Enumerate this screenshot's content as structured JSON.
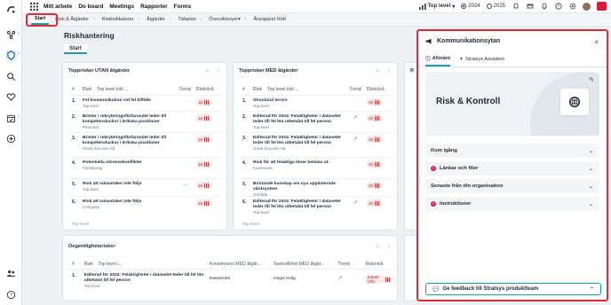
{
  "nav": {
    "items": [
      "Mitt arbete",
      "Do board",
      "Meetings",
      "Rapporter",
      "Forms"
    ]
  },
  "topbar": {
    "level_label": "Top level",
    "years": [
      "2024",
      "2025"
    ]
  },
  "breadcrumb": {
    "items": [
      "Start",
      "Risk & Åtgärder",
      "Riskindikatorer",
      "Åtgärder",
      "Tidsplan",
      "Översiktsvyer",
      "Årsrapport RoK"
    ]
  },
  "page": {
    "title": "Riskhantering",
    "tab": "Start"
  },
  "card1": {
    "title": "Topprisker UTAN åtgärder",
    "headers": [
      "#",
      "Risk",
      "Top level inkl ...",
      "Trend",
      "Risknivå"
    ],
    "rows": [
      {
        "num": "1.",
        "title": "Fel kommunikation vid fel tillfälle",
        "sub": "Top level",
        "trend": "",
        "level": "16"
      },
      {
        "num": "2.",
        "title": "Brister i rekryteringsförfarandet leder till kompetensluckor i kritiska positioner",
        "sub": "Personal",
        "trend": "",
        "level": "16"
      },
      {
        "num": "3.",
        "title": "Brister i rekryteringsförfarandet leder till kompetensluckor i kritiska positioner",
        "sub": "Great Success AB",
        "trend": "",
        "level": "16"
      },
      {
        "num": "4.",
        "title": "Potentiella intressekonflikter",
        "sub": "Försäljning",
        "trend": "",
        "level": "16"
      },
      {
        "num": "5.",
        "title": "Risk att ramavtalen inte följs",
        "sub": "Top level",
        "trend": "→",
        "level": "16"
      },
      {
        "num": "6.",
        "title": "Risk att ramavtalen inte följs",
        "sub": "Company",
        "trend": "",
        "level": "16"
      }
    ],
    "footer": "Top level"
  },
  "card2": {
    "title": "Topprisker MED åtgärder",
    "headers": [
      "#",
      "Risk",
      "Top level inkl ...",
      "Trend",
      "Risknivå"
    ],
    "rows": [
      {
        "num": "1.",
        "title": "Structural errors",
        "sub": "Top level",
        "trend": "",
        "level": "25"
      },
      {
        "num": "2.",
        "title": "Editerad för 2024: Felaktigheter i datasetet leder till fel lön utbetalat till fel person",
        "sub": "Top level",
        "trend": "↗",
        "level": "20"
      },
      {
        "num": "3.",
        "title": "Editerad för 2024: Felaktigheter i datasetet leder till fel lön utbetalat till fel person",
        "sub": "Great Success AB",
        "trend": "↗",
        "level": "20"
      },
      {
        "num": "4.",
        "title": "Risk för att felaktiga löner betalas ut.",
        "sub": "Kommuner",
        "trend": "",
        "level": "20"
      },
      {
        "num": "5.",
        "title": "Bristande kunskap om nya uppdaterade vårdsystem",
        "sub": "Område",
        "trend": "",
        "level": "20"
      },
      {
        "num": "6.",
        "title": "Editerad för 2024: Felaktigheter i datasetet leder till fel lön utbetalat till fel person",
        "sub": "Top level",
        "trend": "↗",
        "level": "20"
      }
    ],
    "footer": "Top level"
  },
  "card3": {
    "title": "Oegentlighetsrisker",
    "headers": [
      "#",
      "Risk",
      "Top level i...",
      "Konsekvens MED åtgär...",
      "Sannolikhet MED åtgär...",
      "Trend",
      "Risknivå"
    ],
    "row": {
      "num": "1.",
      "title": "Editerad för 2024: Felaktigheter i datasetet leder till fel lön utbetalat till fel person",
      "sub": "Top level",
      "consequence": "Katastrofal",
      "probability": "Högst trolig",
      "trend": "↗",
      "level": "Kritisk (25)"
    }
  },
  "ghost": {
    "title": "R"
  },
  "panel": {
    "title": "Kommunikationsytan",
    "tabs": [
      "Allmänt",
      "Stratsys Assistent"
    ],
    "hero_title": "Risk & Kontroll",
    "sections": [
      {
        "label": "Kom igång",
        "alert": false
      },
      {
        "label": "Länkar och filer",
        "alert": true
      },
      {
        "label": "Senaste från din organisation",
        "alert": false
      },
      {
        "label": "Instruktioner",
        "alert": true
      }
    ],
    "feedback": "Ge feedback till Stratsys produktteam"
  },
  "colors": {
    "accent": "#1aa0a8",
    "highlight": "#e02b3b",
    "risk": "#d63a3a"
  }
}
